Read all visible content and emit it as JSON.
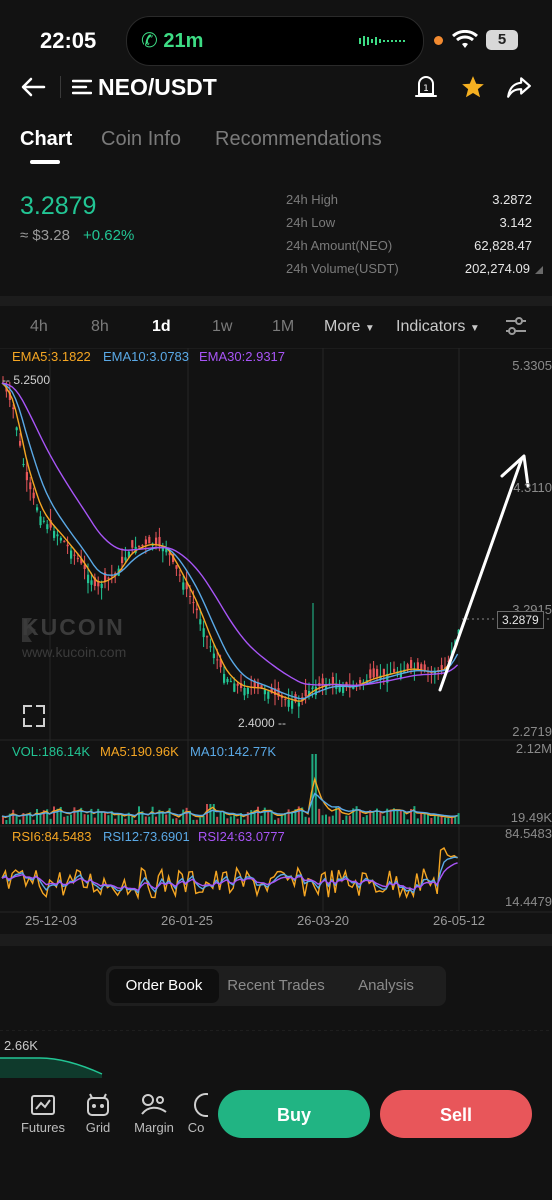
{
  "status_bar": {
    "time": "22:05",
    "call_duration": "21m",
    "battery": "5"
  },
  "header": {
    "pair": "NEO/USDT"
  },
  "tabs": [
    {
      "label": "Chart"
    },
    {
      "label": "Coin Info"
    },
    {
      "label": "Recommendations"
    }
  ],
  "ticker": {
    "last_price": "3.2879",
    "fiat_price": "≈ $3.28",
    "change": "+0.62%",
    "stats": [
      {
        "label": "24h High",
        "value": "3.2872"
      },
      {
        "label": "24h Low",
        "value": "3.142"
      },
      {
        "label": "24h Amount(NEO)",
        "value": "62,828.47"
      },
      {
        "label": "24h Volume(USDT)",
        "value": "202,274.09"
      }
    ]
  },
  "timeframes": [
    "4h",
    "8h",
    "1d",
    "1w",
    "1M"
  ],
  "timeframe_active": "1d",
  "toolbar": {
    "more_label": "More",
    "indicators_label": "Indicators"
  },
  "chart": {
    "ema_legend": [
      {
        "text": "EMA5:3.1822",
        "color": "#f5a623"
      },
      {
        "text": "EMA10:3.0783",
        "color": "#5aa9e6"
      },
      {
        "text": "EMA30:2.9317",
        "color": "#a855f7"
      }
    ],
    "vol_legend": [
      {
        "text": "VOL:186.14K",
        "color": "#22c594"
      },
      {
        "text": "MA5:190.96K",
        "color": "#f5a623"
      },
      {
        "text": "MA10:142.77K",
        "color": "#5aa9e6"
      }
    ],
    "rsi_legend": [
      {
        "text": "RSI6:84.5483",
        "color": "#f5a623"
      },
      {
        "text": "RSI12:73.6901",
        "color": "#5aa9e6"
      },
      {
        "text": "RSI24:63.0777",
        "color": "#a855f7"
      }
    ],
    "price_axis": [
      "5.3305",
      "4.3110",
      "3.2915",
      "2.2719"
    ],
    "current_price_tag": "3.2879",
    "high_marker": "5.2500",
    "low_marker": "2.4000",
    "vol_axis": [
      "2.12M",
      "19.49K"
    ],
    "rsi_axis": [
      "84.5483",
      "14.4479"
    ],
    "date_axis": [
      "25-12-03",
      "26-01-25",
      "26-03-20",
      "26-05-12"
    ],
    "watermark_brand": "KUCOIN",
    "watermark_url": "www.kucoin.com"
  },
  "bottom_tabs": [
    "Order Book",
    "Recent Trades",
    "Analysis"
  ],
  "bottom_tab_active": "Order Book",
  "depth_label": "2.66K",
  "nav": [
    "Futures",
    "Grid",
    "Margin",
    "Co"
  ],
  "actions": {
    "buy": "Buy",
    "sell": "Sell"
  },
  "colors": {
    "up": "#22c594",
    "down": "#e8565a",
    "background": "#121212"
  }
}
